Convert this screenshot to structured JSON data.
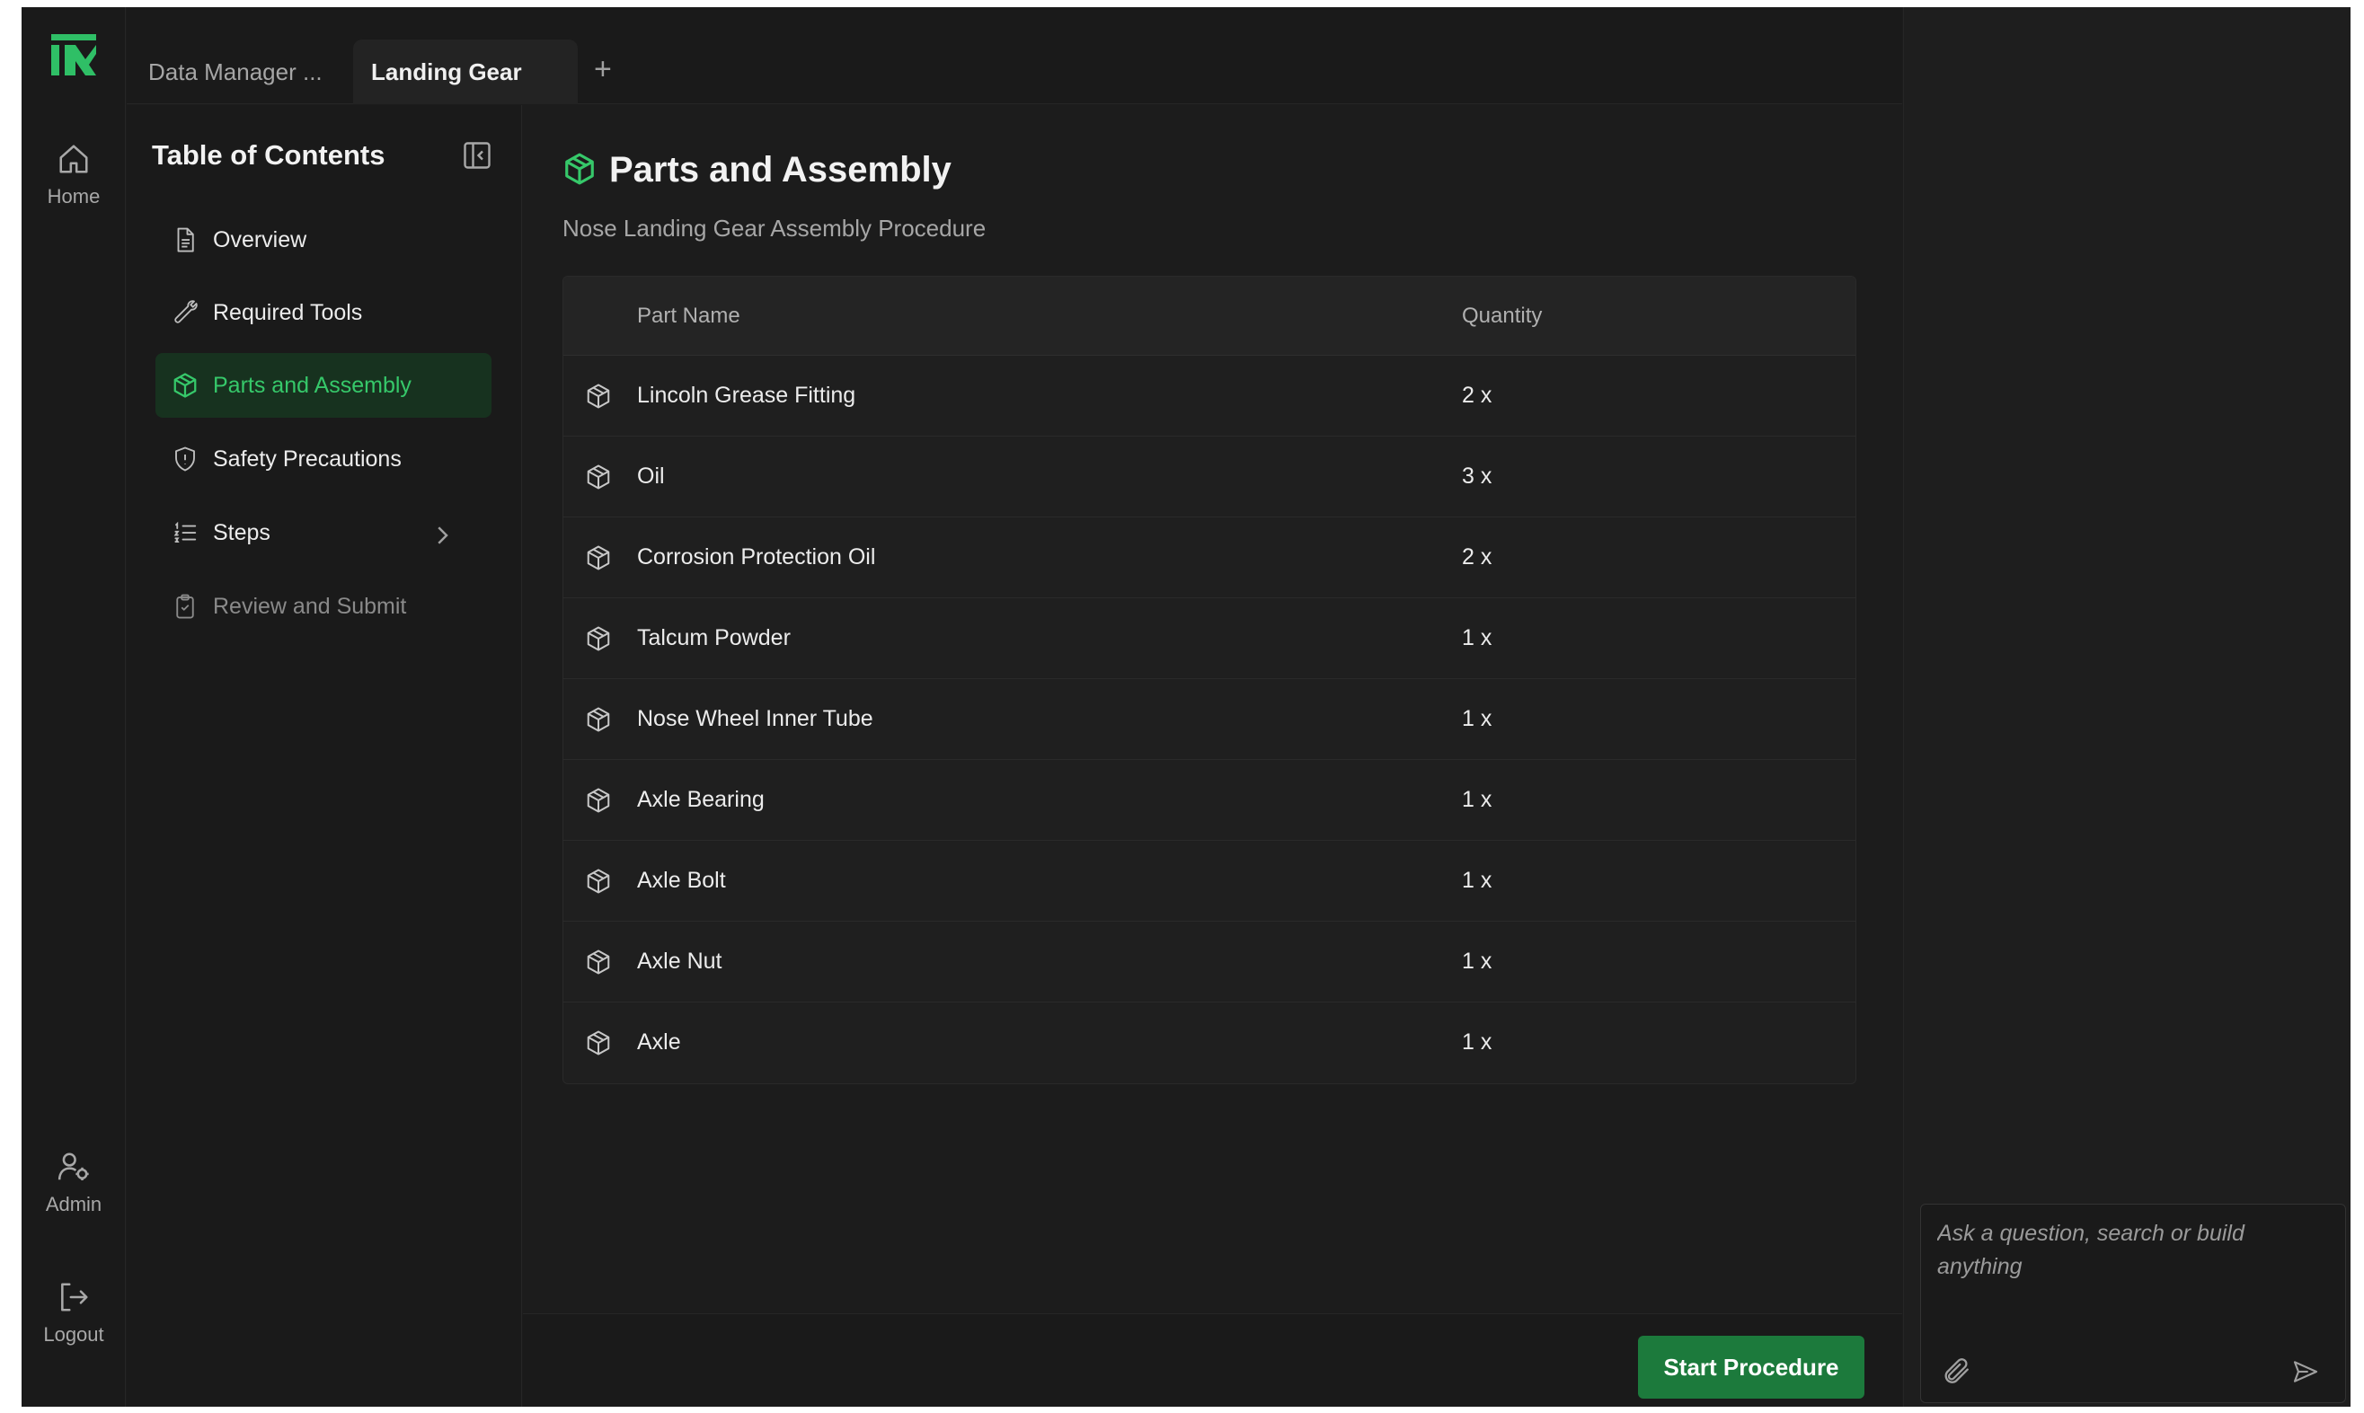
{
  "colors": {
    "accent": "#36c86a",
    "button_bg": "#1c7a3c",
    "background": "#1c1c1c"
  },
  "rail": {
    "logo_icon": "logo-icon",
    "home_label": "Home",
    "admin_label": "Admin",
    "logout_label": "Logout"
  },
  "tabs": [
    {
      "label": "Data Manager ..."
    },
    {
      "label": "Landing Gear"
    }
  ],
  "tab_add_label": "+",
  "toc": {
    "title": "Table of Contents",
    "items": [
      {
        "label": "Overview",
        "icon": "document-icon"
      },
      {
        "label": "Required Tools",
        "icon": "wrench-icon"
      },
      {
        "label": "Parts and Assembly",
        "icon": "package-icon"
      },
      {
        "label": "Safety Precautions",
        "icon": "shield-icon"
      },
      {
        "label": "Steps",
        "icon": "list-icon"
      },
      {
        "label": "Review and Submit",
        "icon": "clipboard-icon"
      }
    ]
  },
  "main": {
    "title": "Parts and Assembly",
    "subtitle": "Nose Landing Gear Assembly Procedure",
    "table": {
      "headers": {
        "name": "Part Name",
        "quantity": "Quantity"
      },
      "rows": [
        {
          "name": "Lincoln Grease Fitting",
          "quantity": "2 x"
        },
        {
          "name": "Oil",
          "quantity": "3 x"
        },
        {
          "name": "Corrosion Protection Oil",
          "quantity": "2 x"
        },
        {
          "name": "Talcum Powder",
          "quantity": "1 x"
        },
        {
          "name": "Nose Wheel Inner Tube",
          "quantity": "1 x"
        },
        {
          "name": "Axle Bearing",
          "quantity": "1 x"
        },
        {
          "name": "Axle Bolt",
          "quantity": "1 x"
        },
        {
          "name": "Axle Nut",
          "quantity": "1 x"
        },
        {
          "name": "Axle",
          "quantity": "1 x"
        }
      ]
    }
  },
  "footer": {
    "start_label": "Start Procedure"
  },
  "assistant": {
    "placeholder": "Ask a question, search or build anything"
  }
}
